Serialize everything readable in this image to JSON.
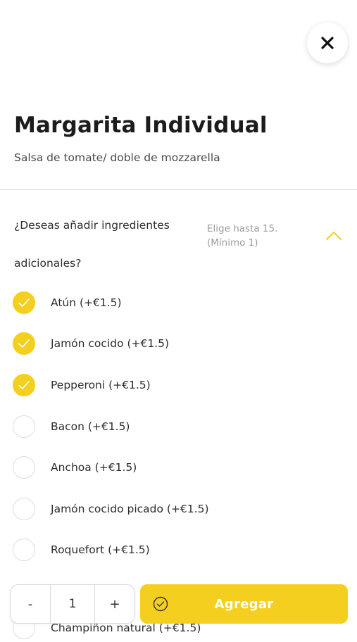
{
  "product": {
    "title": "Margarita Individual",
    "description": "Salsa de tomate/ doble de mozzarella"
  },
  "group": {
    "question_line1": "¿Deseas añadir ingredientes",
    "question_line2": "adicionales?",
    "hint_line1": "Elige hasta 15.",
    "hint_line2": "(Mínimo 1)",
    "options": [
      {
        "label": "Atún (+€1.5)",
        "checked": true
      },
      {
        "label": "Jamón cocido (+€1.5)",
        "checked": true
      },
      {
        "label": "Pepperoni (+€1.5)",
        "checked": true
      },
      {
        "label": "Bacon (+€1.5)",
        "checked": false
      },
      {
        "label": "Anchoa (+€1.5)",
        "checked": false
      },
      {
        "label": "Jamón cocido picado (+€1.5)",
        "checked": false
      },
      {
        "label": "Roquefort (+€1.5)",
        "checked": false
      },
      {
        "label": "Champiñon natural (+€1.5)",
        "checked": false
      }
    ]
  },
  "quantity": {
    "minus_label": "-",
    "value": "1",
    "plus_label": "+"
  },
  "add_button": {
    "label": "Agregar"
  },
  "colors": {
    "accent": "#f5cf1f",
    "text": "#2b2b2b",
    "muted": "#9b9b9b"
  },
  "icons": {
    "close": "close-icon",
    "collapse": "chevron-up-icon",
    "check": "check-icon",
    "confirm": "check-circle-icon"
  }
}
